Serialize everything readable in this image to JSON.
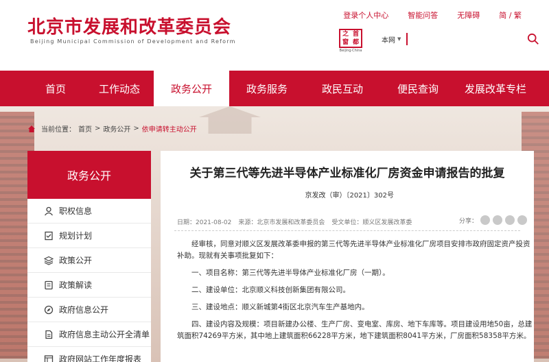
{
  "header": {
    "title": "北京市发展和改革委员会",
    "subtitle": "Beijing Municipal Commission of Development and Reform",
    "top_links": [
      "登录个人中心",
      "智能问答",
      "无障碍",
      "简 / 繁"
    ],
    "seal": {
      "chars": [
        "之",
        "首",
        "窗",
        "都"
      ],
      "caption": "Beijing·China"
    },
    "search": {
      "scope": "本网",
      "placeholder": ""
    }
  },
  "nav": {
    "items": [
      "首页",
      "工作动态",
      "政务公开",
      "政务服务",
      "政民互动",
      "便民查询",
      "发展改革专栏"
    ],
    "active_index": 2
  },
  "breadcrumb": {
    "label": "当前位置：",
    "items": [
      "首页",
      "政务公开",
      "依申请转主动公开"
    ],
    "separator": ">"
  },
  "sidebar": {
    "title": "政务公开",
    "items": [
      {
        "label": "职权信息",
        "icon": "person-icon"
      },
      {
        "label": "规划计划",
        "icon": "checklist-icon"
      },
      {
        "label": "政策公开",
        "icon": "layers-icon"
      },
      {
        "label": "政策解读",
        "icon": "book-icon"
      },
      {
        "label": "政府信息公开",
        "icon": "compass-icon"
      },
      {
        "label": "政府信息主动公开全清单",
        "icon": "document-icon"
      },
      {
        "label": "政府网站工作年度报表",
        "icon": "report-icon"
      }
    ]
  },
  "article": {
    "title": "关于第三代等先进半导体产业标准化厂房资金申请报告的批复",
    "doc_number": "京发改（审）〔2021〕302号",
    "meta": {
      "date": "日期：2021-08-02",
      "source": "来源：北京市发展和改革委员会",
      "recipient": "受文单位：顺义区发展改革委"
    },
    "share_label": "分享：",
    "paragraphs": [
      "经审核，同意对顺义区发展改革委申报的第三代等先进半导体产业标准化厂房项目安排市政府固定资产投资补助。现就有关事项批复如下：",
      "一、项目名称：第三代等先进半导体产业标准化厂房（一期）。",
      "二、建设单位：北京顺义科技创新集团有限公司。",
      "三、建设地点：顺义新城第4街区北京汽车生产基地内。",
      "四、建设内容及规模：项目新建办公楼、生产厂房、变电室、库房、地下车库等。项目建设用地50亩，总建筑面积74269平方米，其中地上建筑面积66228平方米，地下建筑面积8041平方米，厂房面积58358平方米。"
    ]
  },
  "colors": {
    "brand_red": "#c8102e"
  }
}
